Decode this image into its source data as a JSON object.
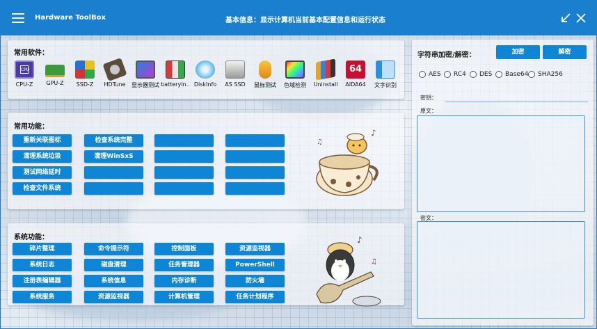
{
  "app": {
    "title": "Hardware ToolBox",
    "center_title": "基本信息：显示计算机当前基本配置信息和运行状态",
    "accent": "#1b7fcf"
  },
  "software": {
    "label": "常用软件：",
    "items": [
      {
        "label": "CPU-Z",
        "icon": "cpu-chip-icon"
      },
      {
        "label": "GPU-Z",
        "icon": "graphics-card-icon"
      },
      {
        "label": "SSD-Z",
        "icon": "ssd-icon"
      },
      {
        "label": "HDTune",
        "icon": "hard-disk-icon"
      },
      {
        "label": "显示器测试",
        "icon": "monitor-test-icon"
      },
      {
        "label": "batteryIn...",
        "icon": "battery-icon"
      },
      {
        "label": "DiskInfo",
        "icon": "disk-info-icon"
      },
      {
        "label": "AS SSD",
        "icon": "as-ssd-icon"
      },
      {
        "label": "鼠标测试",
        "icon": "mouse-icon"
      },
      {
        "label": "色域检测",
        "icon": "color-gamut-icon"
      },
      {
        "label": "Uninstall",
        "icon": "uninstall-icon"
      },
      {
        "label": "AIDA64",
        "icon": "aida64-icon"
      },
      {
        "label": "文字识别",
        "icon": "ocr-icon"
      }
    ]
  },
  "functions": {
    "label": "常用功能：",
    "buttons": [
      "重新关联图标",
      "检查系统完整",
      "",
      "",
      "清理系统垃圾",
      "清理WinSxS",
      "",
      "",
      "测试网络延时",
      "",
      "",
      "",
      "检查文件系统",
      "",
      "",
      ""
    ]
  },
  "system": {
    "label": "系统功能：",
    "buttons": [
      "碎片整理",
      "命令提示符",
      "控制面板",
      "资源监视器",
      "系统日志",
      "磁盘清理",
      "任务管理器",
      "PowerShell",
      "注册表编辑器",
      "系统信息",
      "内存诊断",
      "防火墙",
      "系统服务",
      "资源监视器",
      "计算机管理",
      "任务计划程序"
    ]
  },
  "crypto": {
    "title": "字符串加密/解密：",
    "encrypt": "加密",
    "decrypt": "解密",
    "algorithms": [
      "AES",
      "RC4",
      "DES",
      "Base64",
      "SHA256"
    ],
    "key_label": "密钥：",
    "key_value": "",
    "plain_label": "原文：",
    "plain_value": "",
    "cipher_label": "密文：",
    "cipher_value": ""
  }
}
